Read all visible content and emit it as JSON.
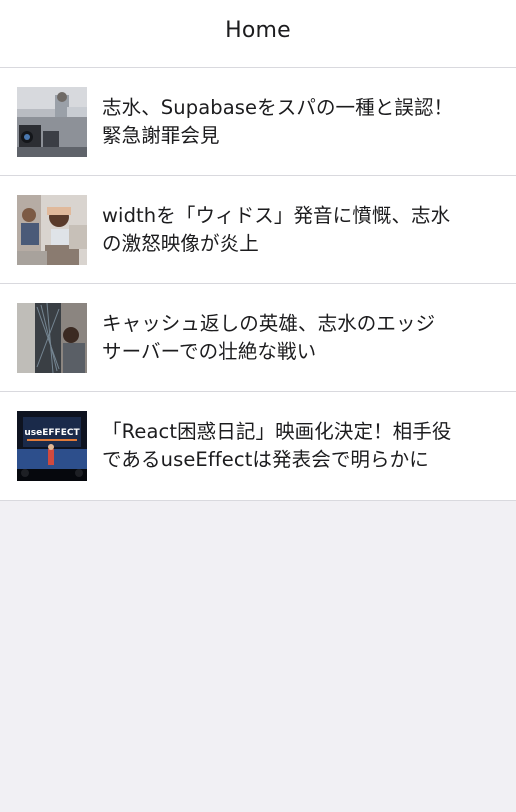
{
  "header": {
    "title": "Home"
  },
  "articles": [
    {
      "title": "志水、Supabaseをスパの一種と誤認！\n緊急謝罪会見",
      "thumbnail_icon": "press-conference-photo"
    },
    {
      "title": "widthを「ウィドス」発音に憤慨、志水\nの激怒映像が炎上",
      "thumbnail_icon": "frustrated-person-photo"
    },
    {
      "title": "キャッシュ返しの英雄、志水のエッジ\nサーバーでの壮絶な戦い",
      "thumbnail_icon": "server-rack-photo"
    },
    {
      "title": "「React困惑日記」映画化決定！相手役\nであるuseEffectは発表会で明らかに",
      "thumbnail_icon": "stage-presentation-photo",
      "thumbnail_text": "useEFFECT"
    }
  ]
}
